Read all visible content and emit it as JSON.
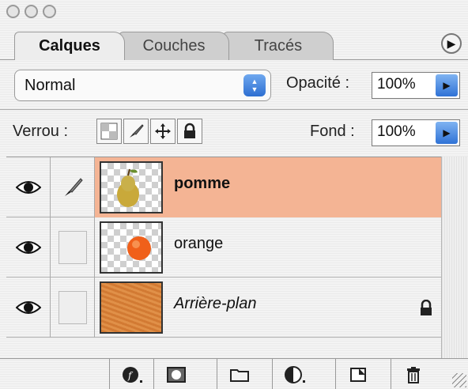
{
  "tabs": [
    {
      "label": "Calques",
      "active": true
    },
    {
      "label": "Couches",
      "active": false
    },
    {
      "label": "Tracés",
      "active": false
    }
  ],
  "blend": {
    "mode": "Normal"
  },
  "opacity": {
    "label": "Opacité :",
    "value": "100%"
  },
  "lock": {
    "label": "Verrou :"
  },
  "fill": {
    "label": "Fond :",
    "value": "100%"
  },
  "layers": [
    {
      "name": "pomme",
      "selected": true,
      "visible": true,
      "thumb": "pear-thumbnail"
    },
    {
      "name": "orange",
      "selected": false,
      "visible": true,
      "thumb": "orange-thumbnail"
    },
    {
      "name": "Arrière-plan",
      "selected": false,
      "visible": true,
      "locked": true,
      "thumb": "texture-thumbnail"
    }
  ],
  "colors": {
    "selection": "#f4b494",
    "accent": "#2f72d6",
    "background_layer": "#d9823a"
  },
  "bottom_buttons": [
    "layer-style-icon",
    "mask-icon",
    "folder-icon",
    "adjustment-icon",
    "new-layer-icon",
    "trash-icon"
  ]
}
